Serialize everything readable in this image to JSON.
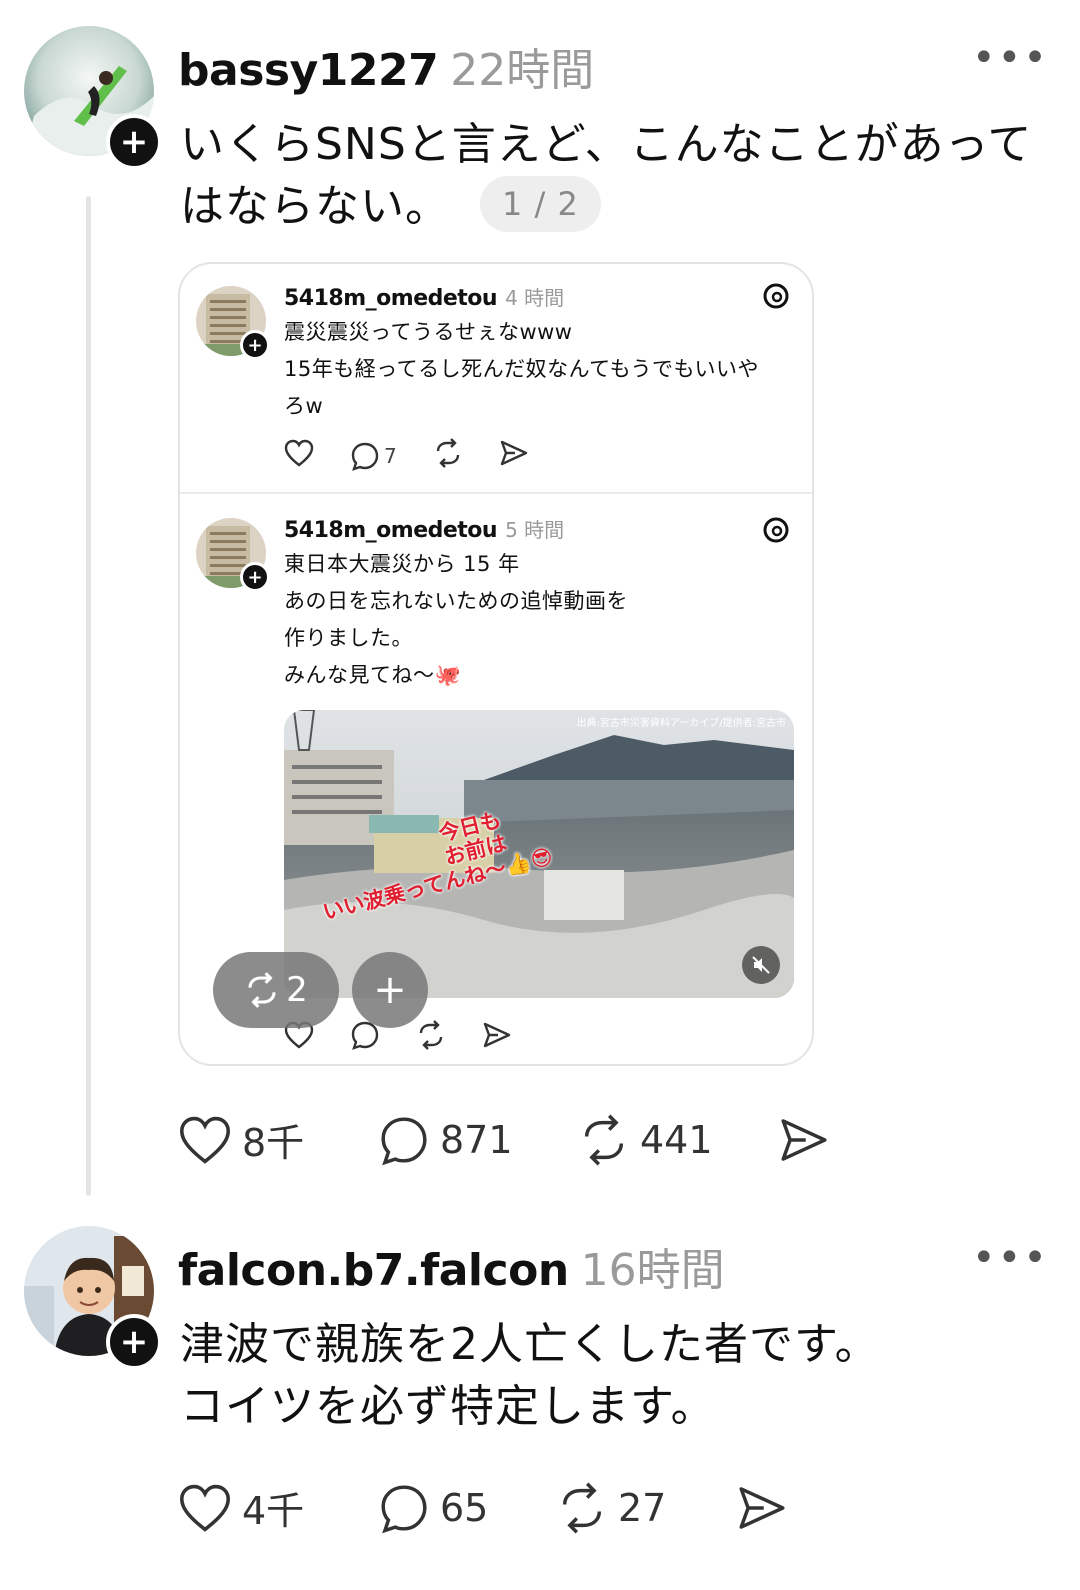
{
  "post1": {
    "username": "bassy1227",
    "time": "22時間",
    "text_line1": "いくらSNSと言えど、こんなことがあって",
    "text_line2": "はならない。",
    "pager": "1 / 2",
    "quote": {
      "items": [
        {
          "username": "5418m_omedetou",
          "time": "4 時間",
          "lines": [
            "震災震災ってうるせぇなwww",
            "15年も経ってるし死んだ奴なんてもうでもいいや",
            "ろw"
          ],
          "reply_count": "7"
        },
        {
          "username": "5418m_omedetou",
          "time": "5 時間",
          "lines": [
            "東日本大震災から 15 年",
            "あの日を忘れないための追悼動画を",
            "作りました。",
            "みんな見てね〜🐙"
          ],
          "video_caption1": "今日も",
          "video_caption2": "お前は",
          "video_caption3": "いい波乗ってんね〜👍😎",
          "video_credit": "出典:宮古市災害資料アーカイブ/提供者:宮古市"
        }
      ]
    },
    "overlay_repost_count": "2",
    "likes": "8千",
    "replies": "871",
    "reposts": "441"
  },
  "post2": {
    "username": "falcon.b7.falcon",
    "time": "16時間",
    "text_line1": "津波で親族を2人亡くした者です。",
    "text_line2": "コイツを必ず特定します。",
    "likes": "4千",
    "replies": "65",
    "reposts": "27"
  }
}
